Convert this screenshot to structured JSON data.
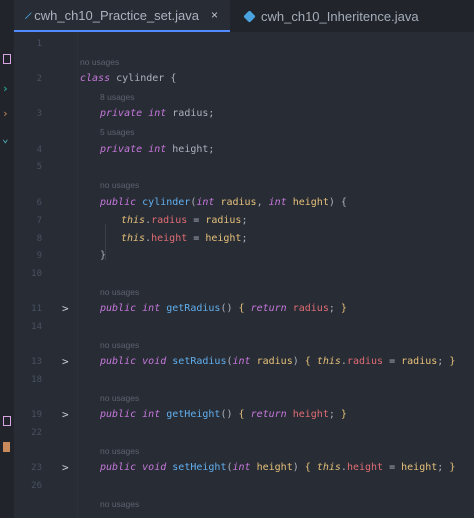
{
  "tabs": [
    {
      "label": "cwh_ch10_Practice_set.java",
      "close": "×",
      "active": true
    },
    {
      "label": "cwh_ch10_Inheritence.java",
      "active": false
    }
  ],
  "colors": {
    "keyword": "#c678dd",
    "function": "#61afef",
    "param": "#e5c07b",
    "field": "#e06c75",
    "hint": "#5c6370"
  },
  "lines": {
    "l1": "1",
    "l2": "2",
    "l3": "3",
    "l4": "4",
    "l5": "5",
    "l6": "6",
    "l7": "7",
    "l8": "8",
    "l9": "9",
    "l10": "10",
    "l11": "11",
    "l14": "14",
    "l13": "13",
    "l18": "18",
    "l19": "19",
    "l22": "22",
    "l23": "23",
    "l26": "26"
  },
  "hints": {
    "h_class": "no usages",
    "h_radius": "8 usages",
    "h_height": "5 usages",
    "h_ctor": "no usages",
    "h_getr": "no usages",
    "h_setr": "no usages",
    "h_geth": "no usages",
    "h_seth": "no usages",
    "h_last": "no usages"
  },
  "code": {
    "class_kw": "class",
    "class_name": "cylinder",
    "brace_open": "{",
    "private": "private",
    "int": "int",
    "radius": "radius",
    "height": "height",
    "semi": ";",
    "public": "public",
    "ctor": "cylinder",
    "this": "this",
    "void": "void",
    "return": "return",
    "getRadius": "getRadius",
    "setRadius": "setRadius",
    "getHeight": "getHeight",
    "setHeight": "setHeight",
    "brace_close": "}"
  },
  "fold_arrow": ">"
}
